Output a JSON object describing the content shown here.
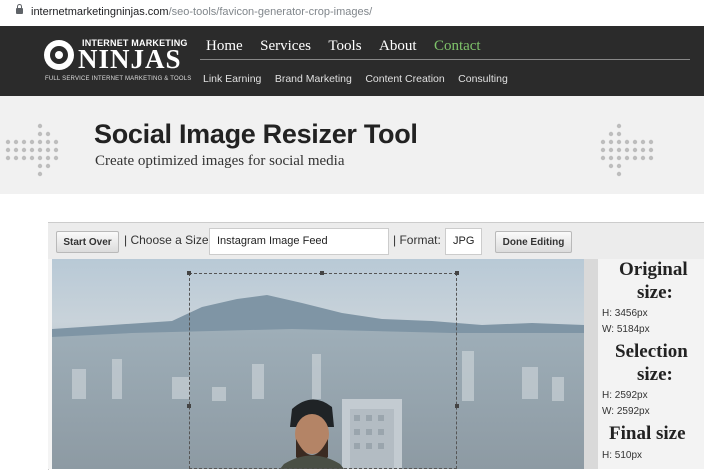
{
  "browser": {
    "url_domain": "internetmarketingninjas.com",
    "url_path": "/seo-tools/favicon-generator-crop-images/"
  },
  "logo": {
    "top_text": "INTERNET MARKETING",
    "main_text": "NINJAS",
    "tagline": "FULL SERVICE INTERNET MARKETING & TOOLS"
  },
  "nav": {
    "main": [
      "Home",
      "Services",
      "Tools",
      "About",
      "Contact"
    ],
    "sub": [
      "Link Earning",
      "Brand Marketing",
      "Content Creation",
      "Consulting"
    ]
  },
  "hero": {
    "title": "Social Image Resizer Tool",
    "subtitle": "Create optimized images for social media"
  },
  "toolbar": {
    "start_over": "Start Over",
    "choose_size_label": "| Choose a Size:",
    "size_value": "Instagram Image Feed",
    "format_label": "| Format:",
    "format_value": "JPG",
    "done_editing": "Done Editing"
  },
  "panel": {
    "original_heading_1": "Original",
    "original_heading_2": "size:",
    "original_h": "H: 3456px",
    "original_w": "W: 5184px",
    "selection_heading_1": "Selection",
    "selection_heading_2": "size:",
    "selection_h": "H: 2592px",
    "selection_w": "W: 2592px",
    "final_heading": "Final size",
    "final_h": "H: 510px"
  },
  "colors": {
    "header_bg": "#2b2b2b",
    "contact_link": "#7ec36a",
    "hero_bg": "#f1f1f1"
  },
  "icons": [
    "lock-icon",
    "ninja-logo-icon",
    "dot-arrow-left-decoration",
    "dot-arrow-right-decoration"
  ]
}
